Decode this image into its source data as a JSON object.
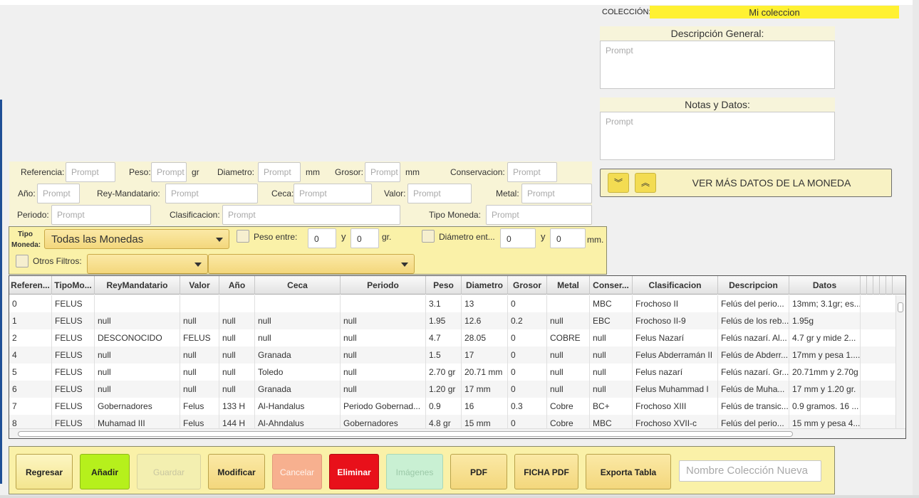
{
  "collection": {
    "label": "COLECCIÓN:",
    "value": "Mi coleccion"
  },
  "descripcion": {
    "title": "Descripción General:",
    "placeholder": "Prompt"
  },
  "notas": {
    "title": "Notas y Datos:",
    "placeholder": "Prompt"
  },
  "ver_mas": {
    "label": "VER MÁS DATOS DE LA MONEDA",
    "down_glyph": "︾",
    "up_glyph": "︽"
  },
  "form": {
    "referencia": {
      "label": "Referencia:",
      "placeholder": "Prompt"
    },
    "peso": {
      "label": "Peso:",
      "placeholder": "Prompt",
      "unit": "gr"
    },
    "diametro": {
      "label": "Diametro:",
      "placeholder": "Prompt",
      "unit": "mm"
    },
    "grosor": {
      "label": "Grosor:",
      "placeholder": "Prompt",
      "unit": "mm"
    },
    "conservacion": {
      "label": "Conservacion:",
      "placeholder": "Prompt"
    },
    "anio": {
      "label": "Año:",
      "placeholder": "Prompt"
    },
    "rey": {
      "label": "Rey-Mandatario:",
      "placeholder": "Prompt"
    },
    "ceca": {
      "label": "Ceca:",
      "placeholder": "Prompt"
    },
    "valor": {
      "label": "Valor:",
      "placeholder": "Prompt"
    },
    "metal": {
      "label": "Metal:",
      "placeholder": "Prompt"
    },
    "periodo": {
      "label": "Periodo:",
      "placeholder": "Prompt"
    },
    "clasificacion": {
      "label": "Clasificacion:",
      "placeholder": "Prompt"
    },
    "tipo_moneda": {
      "label": "Tipo Moneda:",
      "placeholder": "Prompt"
    }
  },
  "filters": {
    "tipo_label_1": "Tipo",
    "tipo_label_2": "Moneda:",
    "tipo_value": "Todas las Monedas",
    "peso_label": "Peso entre:",
    "peso_min": "0",
    "peso_and": "y",
    "peso_max": "0",
    "peso_unit": "gr.",
    "diam_label": "Diámetro ent...",
    "diam_min": "0",
    "diam_and": "y",
    "diam_max": "0",
    "diam_unit": "mm.",
    "otros_label": "Otros Filtros:"
  },
  "table": {
    "columns": [
      "Referen...",
      "TipoMo...",
      "ReyMandatario",
      "Valor",
      "Año",
      "Ceca",
      "Periodo",
      "Peso",
      "Diametro",
      "Grosor",
      "Metal",
      "Conser...",
      "Clasificacion",
      "Descripcion",
      "Datos"
    ],
    "rows": [
      [
        "0",
        "FELUS",
        "",
        "",
        "",
        "",
        "",
        "3.1",
        "13",
        "0",
        "",
        "MBC",
        "Frochoso II",
        "Felús del perio...",
        "13mm; 3.1gr; es..."
      ],
      [
        "1",
        "FELUS",
        "null",
        "null",
        "null",
        "null",
        "null",
        "1.95",
        "12.6",
        "0.2",
        "null",
        "EBC",
        "Frochoso II-9",
        "Felús de los reb...",
        " 1.95g"
      ],
      [
        "2",
        "FELUS",
        "DESCONOCIDO",
        "FELUS",
        "null",
        "null",
        "null",
        "4.7",
        "28.05",
        "0",
        "COBRE",
        "null",
        "Felus Nazarí",
        "Felús nazarí. Al...",
        "4.7 gr y mide 2..."
      ],
      [
        "4",
        "FELUS",
        "null",
        "null",
        "null",
        "Granada",
        "null",
        "1.5",
        "17",
        "0",
        "null",
        "null",
        "Felus Abderramán II",
        "Felús de Abderr...",
        "17mm y pesa 1...."
      ],
      [
        "5",
        "FELUS",
        "null",
        "null",
        "null",
        "Toledo",
        "null",
        "2.70 gr",
        "20.71 mm",
        "0",
        "null",
        "null",
        "Felus nazarí",
        "Felús nazarí. Gr...",
        "20.71mm y 2.70g"
      ],
      [
        "6",
        "FELUS",
        "null",
        "null",
        "null",
        "Granada",
        "null",
        "1.20 gr",
        "17 mm",
        "0",
        "null",
        "null",
        "Felus Muhammad I",
        "Felús de Muha...",
        "17 mm y 1.20 gr."
      ],
      [
        "7",
        "FELUS",
        "Gobernadores",
        "Felus",
        "133 H",
        "Al-Handalus",
        "Periodo Gobernad...",
        "0.9",
        "16",
        "0.3",
        "Cobre",
        "BC+",
        "Frochoso XIII",
        "Felús de transic...",
        "0.9 gramos. 16 ..."
      ],
      [
        "8",
        "FELUS",
        "Muhamad III",
        "Felus",
        "144 H",
        "Al-Ahndalus",
        "Gobernadores",
        "4.8 gr",
        "15 mm",
        "0",
        "Cobre",
        "MBC",
        "Frochoso XVII-c",
        "Felús del perio...",
        "15 mm y pesa 4...."
      ]
    ]
  },
  "buttons": {
    "regresar": "Regresar",
    "anadir": "Añadir",
    "guardar": "Guardar",
    "modificar": "Modificar",
    "cancelar": "Cancelar",
    "eliminar": "Eliminar",
    "imagenes": "Imágenes",
    "pdf": "PDF",
    "ficha_pdf": "FICHA PDF",
    "exporta": "Exporta Tabla",
    "nueva_placeholder": "Nombre Colección Nueva"
  },
  "colors": {
    "collection_bg": "#fff132",
    "anadir_bg": "#b6f01c",
    "eliminar_bg": "#e8101a",
    "cancelar_bg": "#f7b08f",
    "imagenes_bg": "#c9f0d3",
    "panel_bg": "#faf1a8"
  }
}
